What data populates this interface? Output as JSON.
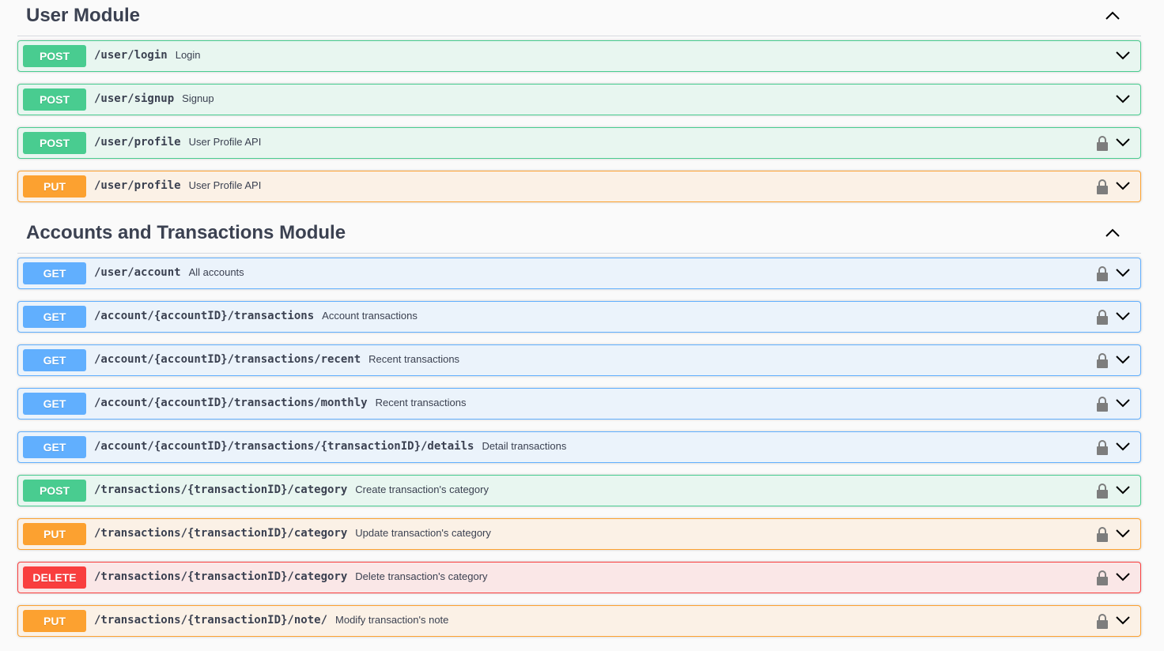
{
  "sections": [
    {
      "title": "User Module",
      "operations": [
        {
          "method": "POST",
          "path": "/user/login",
          "summary": "Login",
          "locked": false
        },
        {
          "method": "POST",
          "path": "/user/signup",
          "summary": "Signup",
          "locked": false
        },
        {
          "method": "POST",
          "path": "/user/profile",
          "summary": "User Profile API",
          "locked": true
        },
        {
          "method": "PUT",
          "path": "/user/profile",
          "summary": "User Profile API",
          "locked": true
        }
      ]
    },
    {
      "title": "Accounts and Transactions Module",
      "operations": [
        {
          "method": "GET",
          "path": "/user/account",
          "summary": "All accounts",
          "locked": true
        },
        {
          "method": "GET",
          "path": "/account/{accountID}/transactions",
          "summary": "Account transactions",
          "locked": true
        },
        {
          "method": "GET",
          "path": "/account/{accountID}/transactions/recent",
          "summary": "Recent transactions",
          "locked": true
        },
        {
          "method": "GET",
          "path": "/account/{accountID}/transactions/monthly",
          "summary": "Recent transactions",
          "locked": true
        },
        {
          "method": "GET",
          "path": "/account/{accountID}/transactions/{transactionID}/details",
          "summary": "Detail transactions",
          "locked": true
        },
        {
          "method": "POST",
          "path": "/transactions/{transactionID}/category",
          "summary": "Create transaction's category",
          "locked": true
        },
        {
          "method": "PUT",
          "path": "/transactions/{transactionID}/category",
          "summary": "Update transaction's category",
          "locked": true
        },
        {
          "method": "DELETE",
          "path": "/transactions/{transactionID}/category",
          "summary": "Delete transaction's category",
          "locked": true
        },
        {
          "method": "PUT",
          "path": "/transactions/{transactionID}/note/",
          "summary": "Modify transaction's note",
          "locked": true
        }
      ]
    }
  ],
  "colors": {
    "post": "#49cc90",
    "put": "#fca130",
    "get": "#61affe",
    "delete": "#f93e3e"
  },
  "icons": {
    "section_toggle": "chevron-up-icon",
    "operation_toggle": "chevron-down-icon",
    "auth": "lock-icon"
  }
}
